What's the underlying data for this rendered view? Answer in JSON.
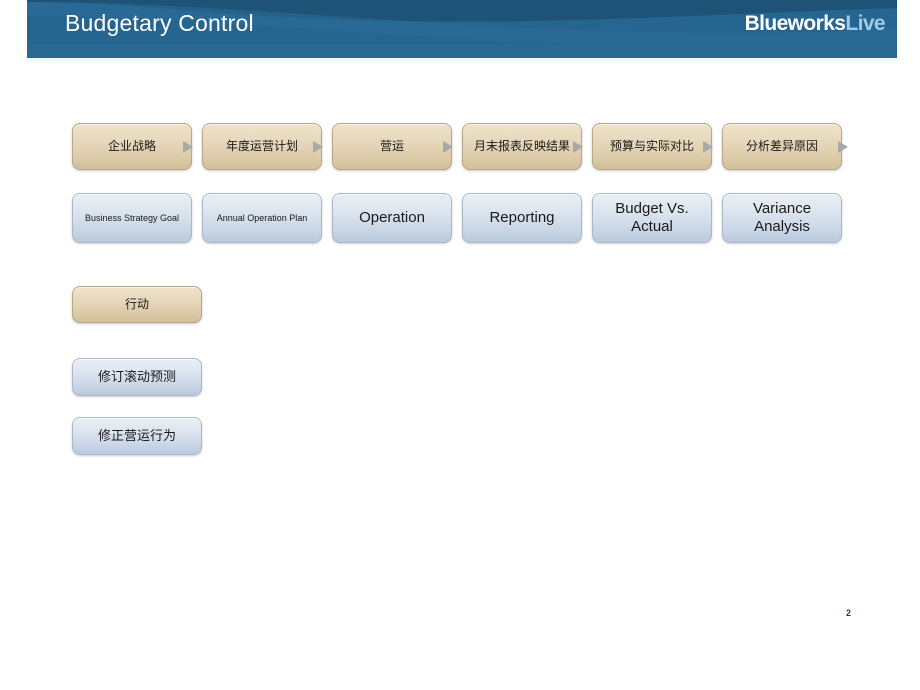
{
  "header": {
    "title": "Budgetary Control",
    "logo_primary": "Blueworks",
    "logo_secondary": "Live",
    "bar_color": "#266590",
    "wave_color": "#1d4f72",
    "logo_secondary_color": "#9ecbe8"
  },
  "process_row_chinese": {
    "fill_color": "#e6d7ba",
    "items": [
      {
        "label": "企业战略",
        "arrow": true
      },
      {
        "label": "年度运营计划",
        "arrow": true
      },
      {
        "label": "营运",
        "arrow": true
      },
      {
        "label": "月末报表反映结果",
        "arrow": true
      },
      {
        "label": "预算与实际对比",
        "arrow": true
      },
      {
        "label": "分析差异原因",
        "arrow": true
      }
    ]
  },
  "process_row_english": {
    "fill_color": "#cdd9e8",
    "items": [
      {
        "label": "Business Strategy Goal",
        "small": true
      },
      {
        "label": "Annual Operation Plan",
        "small": true
      },
      {
        "label": "Operation",
        "small": false
      },
      {
        "label": "Reporting",
        "small": false
      },
      {
        "label": "Budget Vs. Actual",
        "small": false
      },
      {
        "label": "Variance Analysis",
        "small": false
      }
    ]
  },
  "action_section": {
    "action_label": "行动",
    "sub_items": [
      {
        "label": "修订滚动预测"
      },
      {
        "label": "修正营运行为"
      }
    ]
  },
  "footer": {
    "page_number": "2"
  }
}
